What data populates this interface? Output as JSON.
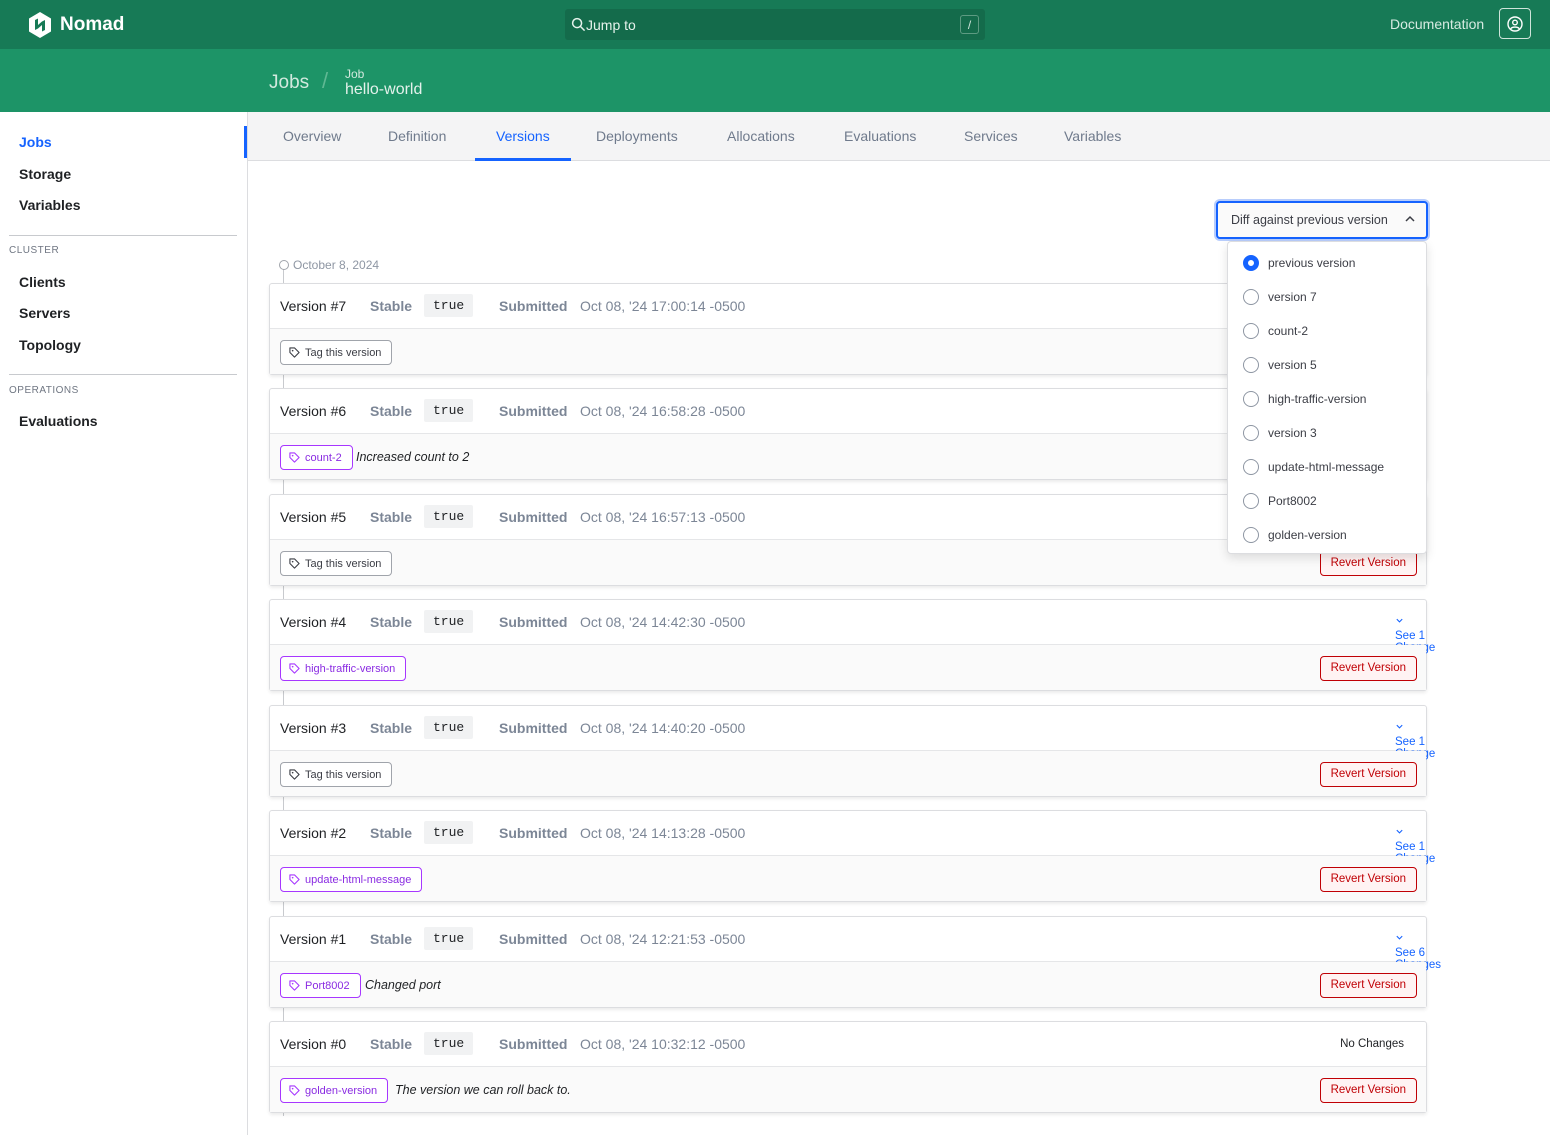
{
  "app": {
    "name": "Nomad",
    "search_placeholder": "Jump to",
    "search_shortcut": "/",
    "documentation": "Documentation"
  },
  "breadcrumb": {
    "jobs": "Jobs",
    "separator": "/",
    "job_label": "Job",
    "job_name": "hello-world"
  },
  "sidebar": {
    "items": [
      {
        "label": "Jobs",
        "active": true
      },
      {
        "label": "Storage"
      },
      {
        "label": "Variables"
      }
    ],
    "cluster_heading": "CLUSTER",
    "cluster_items": [
      "Clients",
      "Servers",
      "Topology"
    ],
    "operations_heading": "OPERATIONS",
    "operations_items": [
      "Evaluations"
    ]
  },
  "tabs": [
    "Overview",
    "Definition",
    "Versions",
    "Deployments",
    "Allocations",
    "Evaluations",
    "Services",
    "Variables"
  ],
  "active_tab": "Versions",
  "diff": {
    "label": "Diff against previous version",
    "options": [
      "previous version",
      "version 7",
      "count-2",
      "version 5",
      "high-traffic-version",
      "version 3",
      "update-html-message",
      "Port8002",
      "golden-version"
    ],
    "selected": "previous version"
  },
  "timeline_date": "October 8, 2024",
  "labels": {
    "stable": "Stable",
    "submitted": "Submitted",
    "revert": "Revert Version",
    "tag_this": "Tag this version"
  },
  "versions": [
    {
      "title": "Version #7",
      "stable": "true",
      "submitted": "Oct 08, '24 17:00:14 -0500",
      "tag": "",
      "description": "",
      "changes": "",
      "revert": false
    },
    {
      "title": "Version #6",
      "stable": "true",
      "submitted": "Oct 08, '24 16:58:28 -0500",
      "tag": "count-2",
      "description": "Increased count to 2",
      "changes": "",
      "revert": true
    },
    {
      "title": "Version #5",
      "stable": "true",
      "submitted": "Oct 08, '24 16:57:13 -0500",
      "tag": "",
      "description": "",
      "changes": "",
      "revert": true
    },
    {
      "title": "Version #4",
      "stable": "true",
      "submitted": "Oct 08, '24 14:42:30 -0500",
      "tag": "high-traffic-version",
      "description": "",
      "changes": "See 1 Change",
      "revert": true
    },
    {
      "title": "Version #3",
      "stable": "true",
      "submitted": "Oct 08, '24 14:40:20 -0500",
      "tag": "",
      "description": "",
      "changes": "See 1 Change",
      "revert": true
    },
    {
      "title": "Version #2",
      "stable": "true",
      "submitted": "Oct 08, '24 14:13:28 -0500",
      "tag": "update-html-message",
      "description": "",
      "changes": "See 1 Change",
      "revert": true
    },
    {
      "title": "Version #1",
      "stable": "true",
      "submitted": "Oct 08, '24 12:21:53 -0500",
      "tag": "Port8002",
      "description": "Changed port",
      "changes": "See 6 Changes",
      "revert": true
    },
    {
      "title": "Version #0",
      "stable": "true",
      "submitted": "Oct 08, '24 10:32:12 -0500",
      "tag": "golden-version",
      "description": "The version we can roll back to.",
      "changes": "No Changes",
      "revert": true
    }
  ],
  "colors": {
    "nav": "#177a56",
    "subheader": "#1d9467",
    "accent": "#1563ff",
    "tag": "#8a2be2",
    "danger": "#c00005"
  }
}
